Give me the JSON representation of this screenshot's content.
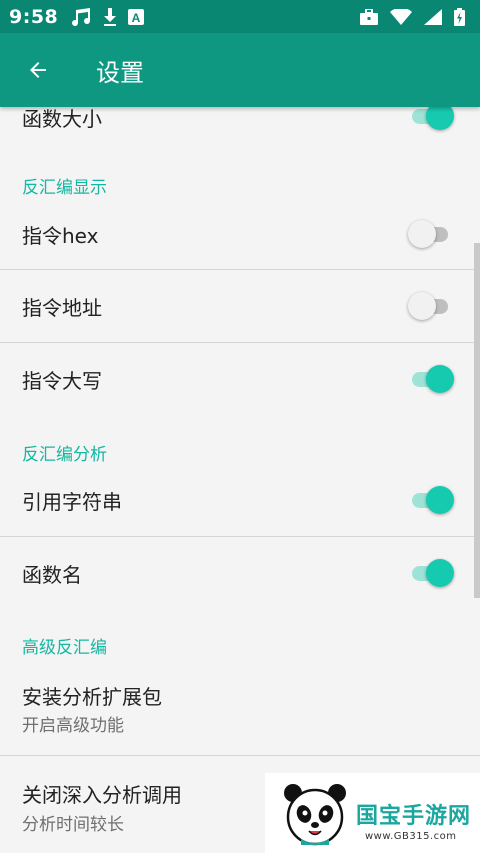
{
  "status_bar": {
    "time": "9:58",
    "icons": [
      "music-note-icon",
      "download-icon",
      "a-badge-icon",
      "briefcase-icon",
      "wifi-icon",
      "signal-icon",
      "battery-icon"
    ]
  },
  "app_bar": {
    "title": "设置"
  },
  "settings": {
    "partial_item": {
      "label": "函数大小",
      "enabled": true
    },
    "sections": [
      {
        "title": "反汇编显示",
        "items": [
          {
            "label": "指令hex",
            "enabled": false
          },
          {
            "label": "指令地址",
            "enabled": false
          },
          {
            "label": "指令大写",
            "enabled": true
          }
        ]
      },
      {
        "title": "反汇编分析",
        "items": [
          {
            "label": "引用字符串",
            "enabled": true
          },
          {
            "label": "函数名",
            "enabled": true
          }
        ]
      },
      {
        "title": "高级反汇编",
        "items": [
          {
            "label": "安装分析扩展包",
            "summary": "开启高级功能"
          },
          {
            "label": "关闭深入分析调用",
            "summary": "分析时间较长"
          }
        ]
      }
    ]
  },
  "watermark": {
    "text": "国宝手游网",
    "url": "www.GB315.com"
  },
  "colors": {
    "status_bar": "#0a8773",
    "app_bar": "#0e9882",
    "accent": "#16cab0",
    "section_text": "#13b8a2"
  }
}
